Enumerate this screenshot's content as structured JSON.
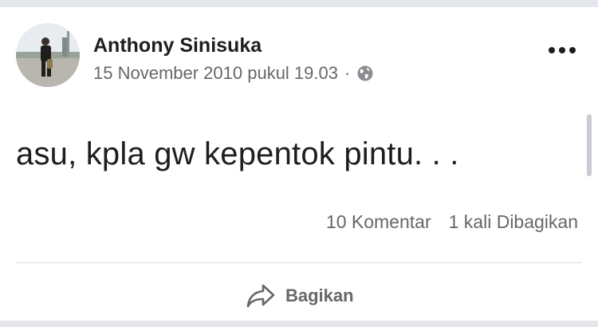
{
  "post": {
    "author": "Anthony Sinisuka",
    "timestamp": "15 November 2010 pukul 19.03",
    "separator": "·",
    "privacy_icon": "globe-icon",
    "text": "asu, kpla gw kepentok pintu. . .",
    "comments_label": "10 Komentar",
    "shares_label": "1 kali Dibagikan",
    "share_button_label": "Bagikan"
  },
  "colors": {
    "text_primary": "#1c1e21",
    "text_secondary": "#65676b",
    "divider": "#dadde1",
    "page_bg_strip": "#e4e6eb"
  }
}
